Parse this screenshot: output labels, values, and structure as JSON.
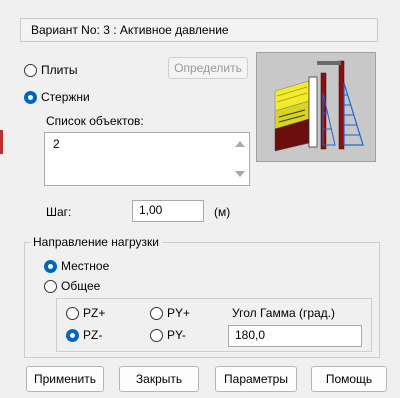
{
  "header": {
    "variant_text": "Вариант No: 3 : Активное давление"
  },
  "object_type": {
    "plates_label": "Плиты",
    "bars_label": "Стержни",
    "selected": "bars",
    "define_button": "Определить"
  },
  "objects": {
    "list_label": "Список объектов:",
    "items": [
      "2"
    ]
  },
  "step": {
    "label": "Шаг:",
    "value": "1,00",
    "unit": "(м)"
  },
  "load_direction": {
    "title": "Направление нагрузки",
    "local_label": "Местное",
    "global_label": "Общее",
    "selected": "local",
    "axes": {
      "pz_plus": "PZ+",
      "pz_minus": "PZ-",
      "py_plus": "PY+",
      "py_minus": "PY-",
      "selected": "pz_minus"
    },
    "gamma_label": "Угол Гамма (град.)",
    "gamma_value": "180,0"
  },
  "buttons": {
    "apply": "Применить",
    "close": "Закрыть",
    "params": "Параметры",
    "help": "Помощь"
  },
  "colors": {
    "accent": "#0067c0",
    "soil_yellow": "#f2ea2a",
    "wall_dark_red": "#6e0d0d",
    "diagram_blue": "#1d64d0"
  }
}
